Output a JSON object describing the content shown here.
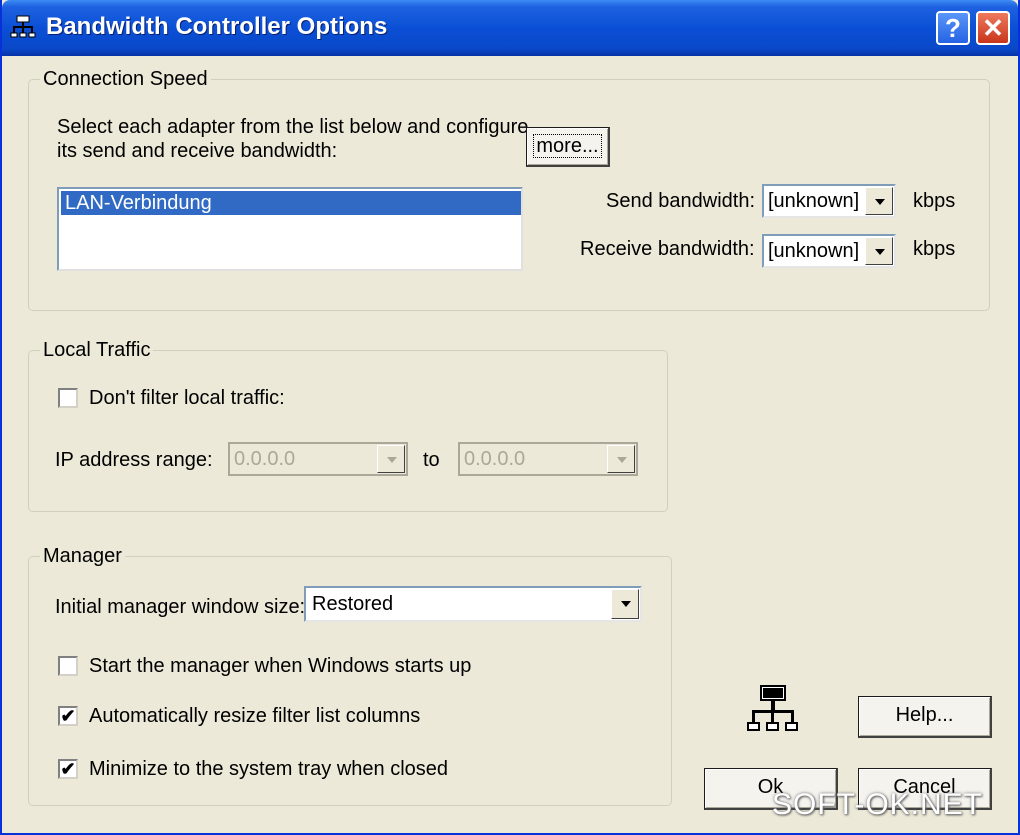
{
  "window": {
    "title": "Bandwidth Controller Options",
    "help_glyph": "?",
    "close_glyph": "✕"
  },
  "connection_speed": {
    "legend": "Connection Speed",
    "description_line1": "Select each adapter from the list below and configure",
    "description_line2": "its send and receive bandwidth:",
    "more_button": "more...",
    "adapters": [
      "LAN-Verbindung"
    ],
    "send_label": "Send bandwidth:",
    "send_value": "[unknown]",
    "receive_label": "Receive bandwidth:",
    "receive_value": "[unknown]",
    "unit": "kbps"
  },
  "local_traffic": {
    "legend": "Local Traffic",
    "dont_filter_label": "Don't filter local traffic:",
    "dont_filter_checked": false,
    "ip_range_label": "IP address range:",
    "ip_from": "0.0.0.0",
    "to_label": "to",
    "ip_to": "0.0.0.0"
  },
  "manager": {
    "legend": "Manager",
    "window_size_label": "Initial manager window size:",
    "window_size_value": "Restored",
    "start_label": "Start the manager when Windows starts up",
    "start_checked": false,
    "resize_label": "Automatically resize filter list columns",
    "resize_checked": true,
    "minimize_label": "Minimize to the system tray when closed",
    "minimize_checked": true,
    "check_glyph": "✔"
  },
  "buttons": {
    "help": "Help...",
    "ok": "Ok",
    "cancel": "Cancel"
  },
  "watermark": "SOFT-OK.NET",
  "icons": {
    "title": "network-icon",
    "app": "network-tree-icon"
  }
}
